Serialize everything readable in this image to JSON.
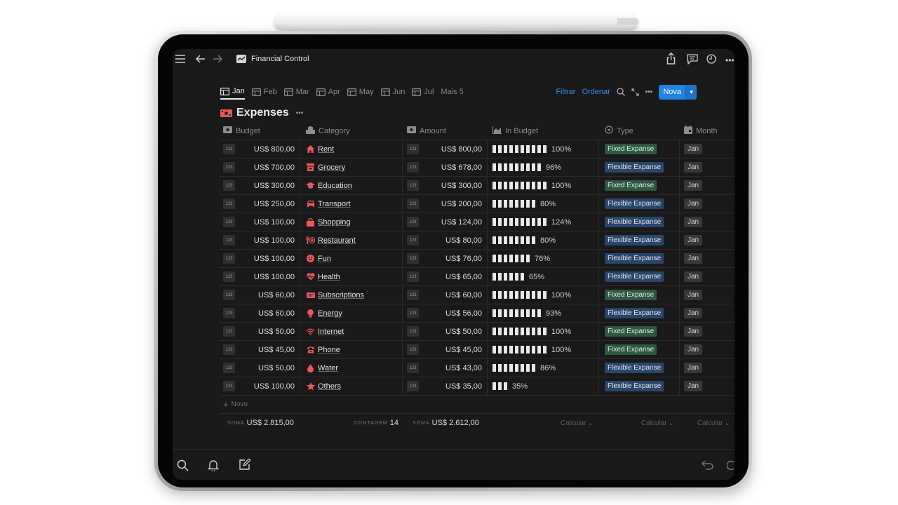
{
  "topbar": {
    "title": "Financial Control",
    "icons": [
      "menu-icon",
      "back-arrow-icon",
      "forward-arrow-icon",
      "page-icon",
      "share-icon",
      "comment-icon",
      "clock-icon",
      "more-icon"
    ]
  },
  "view_tabs": [
    {
      "label": "Jan",
      "active": true
    },
    {
      "label": "Feb",
      "active": false
    },
    {
      "label": "Mar",
      "active": false
    },
    {
      "label": "Apr",
      "active": false
    },
    {
      "label": "May",
      "active": false
    },
    {
      "label": "Jun",
      "active": false
    },
    {
      "label": "Jul",
      "active": false
    }
  ],
  "more_views": "Mais 5",
  "controls": {
    "filter": "Filtrar",
    "sort": "Ordenar",
    "new_button": "Nova"
  },
  "database": {
    "title": "Expenses",
    "title_icon": "money-icon"
  },
  "columns": [
    {
      "label": "Budget",
      "icon": "money-icon"
    },
    {
      "label": "Category",
      "icon": "relation-icon"
    },
    {
      "label": "Amount",
      "icon": "money-icon"
    },
    {
      "label": "In Budget",
      "icon": "chart-icon"
    },
    {
      "label": "Type",
      "icon": "select-icon"
    },
    {
      "label": "Month",
      "icon": "calendar-icon"
    }
  ],
  "number_badge": "123",
  "rows": [
    {
      "budget": "US$ 800,00",
      "category": "Rent",
      "icon": "house-icon",
      "amount": "US$ 800,00",
      "bars": 10,
      "pct": "100%",
      "type": "Fixed Expanse",
      "type_style": "fixed",
      "month": "Jan"
    },
    {
      "budget": "US$ 700,00",
      "category": "Grocery",
      "icon": "store-icon",
      "amount": "US$ 678,00",
      "bars": 9,
      "pct": "96%",
      "type": "Flexible Expanse",
      "type_style": "flex",
      "month": "Jan"
    },
    {
      "budget": "US$ 300,00",
      "category": "Education",
      "icon": "graduation-cap-icon",
      "amount": "US$ 300,00",
      "bars": 10,
      "pct": "100%",
      "type": "Fixed Expanse",
      "type_style": "fixed",
      "month": "Jan"
    },
    {
      "budget": "US$ 250,00",
      "category": "Transport",
      "icon": "car-icon",
      "amount": "US$ 200,00",
      "bars": 8,
      "pct": "80%",
      "type": "Flexible Expanse",
      "type_style": "flex",
      "month": "Jan"
    },
    {
      "budget": "US$ 100,00",
      "category": "Shopping",
      "icon": "shopping-bag-icon",
      "amount": "US$ 124,00",
      "bars": 10,
      "pct": "124%",
      "type": "Flexible Expanse",
      "type_style": "flex",
      "month": "Jan"
    },
    {
      "budget": "US$ 100,00",
      "category": "Restaurant",
      "icon": "restaurant-icon",
      "amount": "US$ 80,00",
      "bars": 8,
      "pct": "80%",
      "type": "Flexible Expanse",
      "type_style": "flex",
      "month": "Jan"
    },
    {
      "budget": "US$ 100,00",
      "category": "Fun",
      "icon": "smile-icon",
      "amount": "US$ 76,00",
      "bars": 7,
      "pct": "76%",
      "type": "Flexible Expanse",
      "type_style": "flex",
      "month": "Jan"
    },
    {
      "budget": "US$ 100,00",
      "category": "Health",
      "icon": "heart-pulse-icon",
      "amount": "US$ 65,00",
      "bars": 6,
      "pct": "65%",
      "type": "Flexible Expanse",
      "type_style": "flex",
      "month": "Jan"
    },
    {
      "budget": "US$ 60,00",
      "category": "Subscriptions",
      "icon": "ticket-icon",
      "amount": "US$ 60,00",
      "bars": 10,
      "pct": "100%",
      "type": "Fixed Expanse",
      "type_style": "fixed",
      "month": "Jan"
    },
    {
      "budget": "US$ 60,00",
      "category": "Energy",
      "icon": "lightbulb-icon",
      "amount": "US$ 56,00",
      "bars": 9,
      "pct": "93%",
      "type": "Flexible Expanse",
      "type_style": "flex",
      "month": "Jan"
    },
    {
      "budget": "US$ 50,00",
      "category": "Internet",
      "icon": "wifi-icon",
      "amount": "US$ 50,00",
      "bars": 10,
      "pct": "100%",
      "type": "Fixed Expanse",
      "type_style": "fixed",
      "month": "Jan"
    },
    {
      "budget": "US$ 45,00",
      "category": "Phone",
      "icon": "telephone-icon",
      "amount": "US$ 45,00",
      "bars": 10,
      "pct": "100%",
      "type": "Fixed Expanse",
      "type_style": "fixed",
      "month": "Jan"
    },
    {
      "budget": "US$ 50,00",
      "category": "Water",
      "icon": "water-drop-icon",
      "amount": "US$ 43,00",
      "bars": 8,
      "pct": "86%",
      "type": "Flexible Expanse",
      "type_style": "flex",
      "month": "Jan"
    },
    {
      "budget": "US$ 100,00",
      "category": "Others",
      "icon": "star-icon",
      "amount": "US$ 35,00",
      "bars": 3,
      "pct": "35%",
      "type": "Flexible Expanse",
      "type_style": "flex",
      "month": "Jan"
    }
  ],
  "new_row": "Novo",
  "summary": {
    "budget_label": "SOMA",
    "budget_value": "US$ 2.815,00",
    "count_label": "CONTAGEM",
    "count_value": "14",
    "amount_label": "SOMA",
    "amount_value": "US$ 2.612,00",
    "calc1": "Calcular",
    "calc2": "Calcular",
    "calc3": "Calcular"
  },
  "bottombar": {
    "icons": [
      "search-icon",
      "bell-icon",
      "compose-icon",
      "undo-icon",
      "redo-icon"
    ]
  },
  "colors": {
    "accent": "#2383e2",
    "icon_red": "#eb5757",
    "fixed_tag": "#2b593f",
    "flexible_tag": "#28456c",
    "screen_bg": "#191919"
  }
}
